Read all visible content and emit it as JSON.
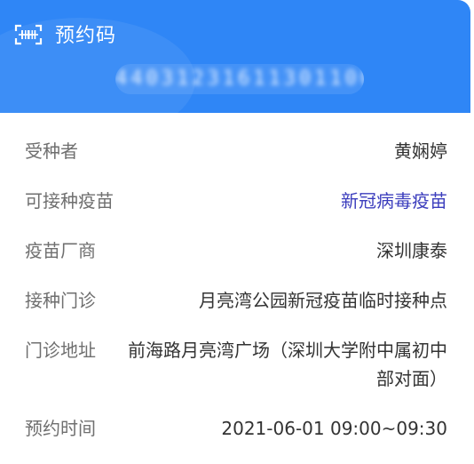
{
  "header": {
    "title": "预约码",
    "icon": "barcode-scan-icon",
    "code": "44031231611301100",
    "bg_color": "#2f86f6"
  },
  "rows": [
    {
      "label": "受种者",
      "value": "黄娴婷"
    },
    {
      "label": "可接种疫苗",
      "value": "新冠病毒疫苗"
    },
    {
      "label": "疫苗厂商",
      "value": "深圳康泰"
    },
    {
      "label": "接种门诊",
      "value": "月亮湾公园新冠疫苗临时接种点"
    },
    {
      "label": "门诊地址",
      "value": "前海路月亮湾广场（深圳大学附中属初中部对面）"
    },
    {
      "label": "预约时间",
      "value": "2021-06-01 09:00~09:30"
    }
  ],
  "link_color": "#3b3dbd"
}
